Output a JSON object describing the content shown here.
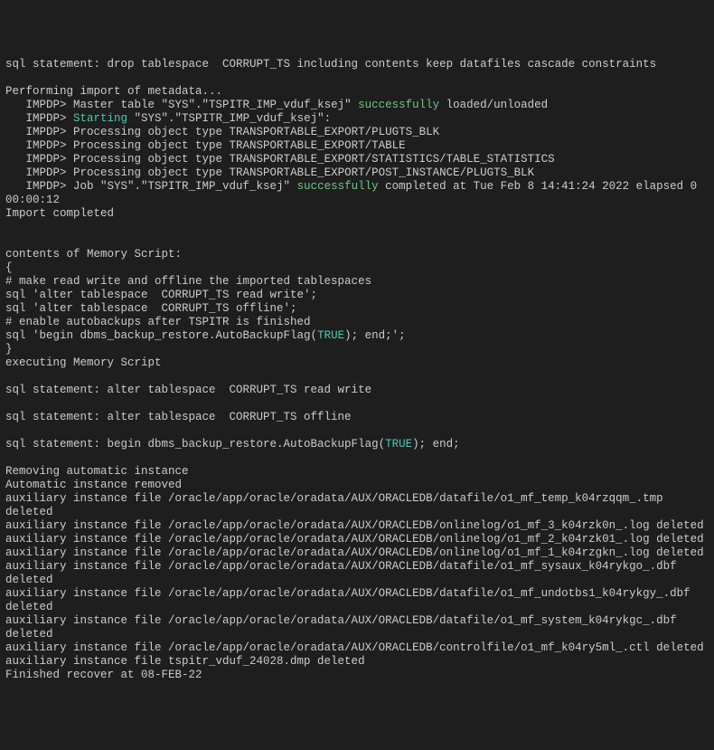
{
  "lines": [
    {
      "segments": [
        {
          "text": "sql statement: drop tablespace  CORRUPT_TS including contents keep datafiles cascade constraints"
        }
      ]
    },
    {
      "segments": [
        {
          "text": ""
        }
      ]
    },
    {
      "segments": [
        {
          "text": "Performing import of metadata..."
        }
      ]
    },
    {
      "segments": [
        {
          "text": "   IMPDP> Master table \"SYS\".\"TSPITR_IMP_vduf_ksej\" "
        },
        {
          "text": "successfully",
          "class": "green-bright"
        },
        {
          "text": " loaded/unloaded"
        }
      ]
    },
    {
      "segments": [
        {
          "text": "   IMPDP> "
        },
        {
          "text": "Starting",
          "class": "teal"
        },
        {
          "text": " \"SYS\".\"TSPITR_IMP_vduf_ksej\":"
        }
      ]
    },
    {
      "segments": [
        {
          "text": "   IMPDP> Processing object type TRANSPORTABLE_EXPORT/PLUGTS_BLK"
        }
      ]
    },
    {
      "segments": [
        {
          "text": "   IMPDP> Processing object type TRANSPORTABLE_EXPORT/TABLE"
        }
      ]
    },
    {
      "segments": [
        {
          "text": "   IMPDP> Processing object type TRANSPORTABLE_EXPORT/STATISTICS/TABLE_STATISTICS"
        }
      ]
    },
    {
      "segments": [
        {
          "text": "   IMPDP> Processing object type TRANSPORTABLE_EXPORT/POST_INSTANCE/PLUGTS_BLK"
        }
      ]
    },
    {
      "segments": [
        {
          "text": "   IMPDP> Job \"SYS\".\"TSPITR_IMP_vduf_ksej\" "
        },
        {
          "text": "successfully",
          "class": "green-bright"
        },
        {
          "text": " completed at Tue Feb 8 14:41:24 2022 elapsed 0 00:00:12"
        }
      ]
    },
    {
      "segments": [
        {
          "text": "Import completed"
        }
      ]
    },
    {
      "segments": [
        {
          "text": ""
        }
      ]
    },
    {
      "segments": [
        {
          "text": ""
        }
      ]
    },
    {
      "segments": [
        {
          "text": "contents of Memory Script:"
        }
      ]
    },
    {
      "segments": [
        {
          "text": "{"
        }
      ]
    },
    {
      "segments": [
        {
          "text": "# make read write and offline the imported tablespaces"
        }
      ]
    },
    {
      "segments": [
        {
          "text": "sql 'alter tablespace  CORRUPT_TS read write';"
        }
      ]
    },
    {
      "segments": [
        {
          "text": "sql 'alter tablespace  CORRUPT_TS offline';"
        }
      ]
    },
    {
      "segments": [
        {
          "text": "# enable autobackups after TSPITR is finished"
        }
      ]
    },
    {
      "segments": [
        {
          "text": "sql 'begin dbms_backup_restore.AutoBackupFlag("
        },
        {
          "text": "TRUE",
          "class": "teal"
        },
        {
          "text": "); end;';"
        }
      ]
    },
    {
      "segments": [
        {
          "text": "}"
        }
      ]
    },
    {
      "segments": [
        {
          "text": "executing Memory Script"
        }
      ]
    },
    {
      "segments": [
        {
          "text": ""
        }
      ]
    },
    {
      "segments": [
        {
          "text": "sql statement: alter tablespace  CORRUPT_TS read write"
        }
      ]
    },
    {
      "segments": [
        {
          "text": ""
        }
      ]
    },
    {
      "segments": [
        {
          "text": "sql statement: alter tablespace  CORRUPT_TS offline"
        }
      ]
    },
    {
      "segments": [
        {
          "text": ""
        }
      ]
    },
    {
      "segments": [
        {
          "text": "sql statement: begin dbms_backup_restore.AutoBackupFlag("
        },
        {
          "text": "TRUE",
          "class": "teal"
        },
        {
          "text": "); end;"
        }
      ]
    },
    {
      "segments": [
        {
          "text": ""
        }
      ]
    },
    {
      "segments": [
        {
          "text": "Removing automatic instance"
        }
      ]
    },
    {
      "segments": [
        {
          "text": "Automatic instance removed"
        }
      ]
    },
    {
      "segments": [
        {
          "text": "auxiliary instance file /oracle/app/oracle/oradata/AUX/ORACLEDB/datafile/o1_mf_temp_k04rzqqm_.tmp deleted"
        }
      ]
    },
    {
      "segments": [
        {
          "text": "auxiliary instance file /oracle/app/oracle/oradata/AUX/ORACLEDB/onlinelog/o1_mf_3_k04rzk0n_.log deleted"
        }
      ]
    },
    {
      "segments": [
        {
          "text": "auxiliary instance file /oracle/app/oracle/oradata/AUX/ORACLEDB/onlinelog/o1_mf_2_k04rzk01_.log deleted"
        }
      ]
    },
    {
      "segments": [
        {
          "text": "auxiliary instance file /oracle/app/oracle/oradata/AUX/ORACLEDB/onlinelog/o1_mf_1_k04rzgkn_.log deleted"
        }
      ]
    },
    {
      "segments": [
        {
          "text": "auxiliary instance file /oracle/app/oracle/oradata/AUX/ORACLEDB/datafile/o1_mf_sysaux_k04rykgo_.dbf deleted"
        }
      ]
    },
    {
      "segments": [
        {
          "text": "auxiliary instance file /oracle/app/oracle/oradata/AUX/ORACLEDB/datafile/o1_mf_undotbs1_k04rykgy_.dbf deleted"
        }
      ]
    },
    {
      "segments": [
        {
          "text": "auxiliary instance file /oracle/app/oracle/oradata/AUX/ORACLEDB/datafile/o1_mf_system_k04rykgc_.dbf deleted"
        }
      ]
    },
    {
      "segments": [
        {
          "text": "auxiliary instance file /oracle/app/oracle/oradata/AUX/ORACLEDB/controlfile/o1_mf_k04ry5ml_.ctl deleted"
        }
      ]
    },
    {
      "segments": [
        {
          "text": "auxiliary instance file tspitr_vduf_24028.dmp deleted"
        }
      ]
    },
    {
      "segments": [
        {
          "text": "Finished recover at 08-FEB-22"
        }
      ]
    }
  ]
}
